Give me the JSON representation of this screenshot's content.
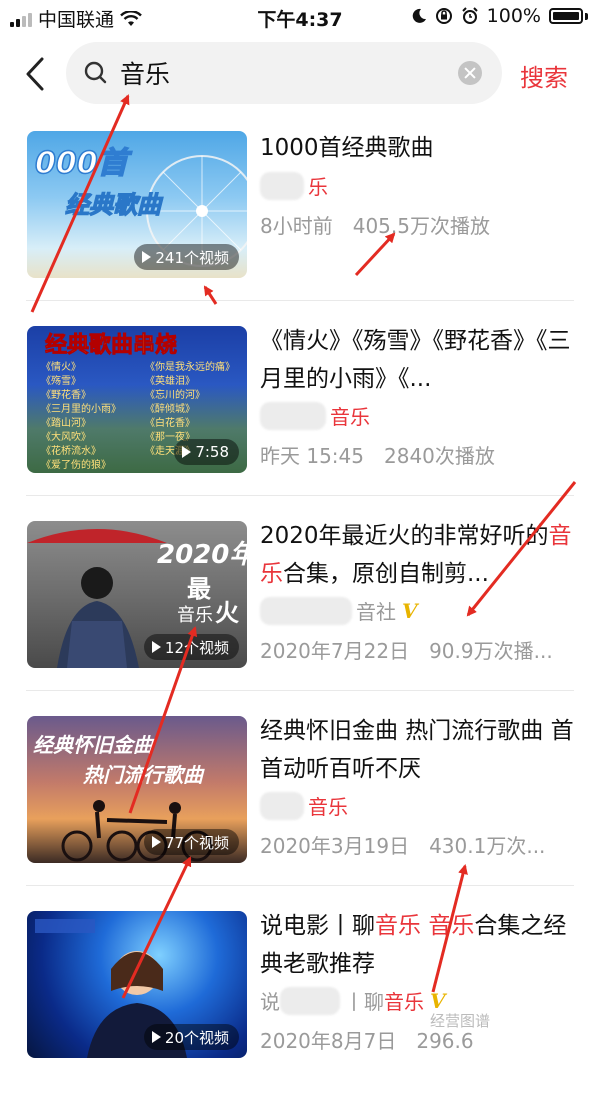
{
  "status": {
    "carrier": "中国联通",
    "time": "下午4:37",
    "battery": "100%"
  },
  "search": {
    "query": "音乐",
    "button": "搜索"
  },
  "results": [
    {
      "title_parts": [
        "1000首经典歌曲"
      ],
      "channel_suffix": "乐",
      "channel_suffix_red": true,
      "vip": false,
      "time": "8小时前",
      "plays": "405.5万次播放",
      "badge": "241个视频"
    },
    {
      "title_parts": [
        "《情火》《殇雪》《野花香》《三月里的小雨》《..."
      ],
      "channel_suffix": "音乐",
      "channel_suffix_red": true,
      "vip": false,
      "time": "昨天 15:45",
      "plays": "2840次播放",
      "badge": "7:58"
    },
    {
      "title_a": "2020年最近火的非常好听的",
      "title_hl": "音乐",
      "title_b": "合集，原创自制剪...",
      "channel_suffix": "音社",
      "channel_suffix_red": false,
      "vip": true,
      "vip_label": "V",
      "time": "2020年7月22日",
      "plays": "90.9万次播...",
      "badge": "12个视频"
    },
    {
      "title_parts": [
        "经典怀旧金曲 热门流行歌曲 首首动听百听不厌"
      ],
      "channel_suffix": "音乐",
      "channel_suffix_red": true,
      "vip": false,
      "time": "2020年3月19日",
      "plays": "430.1万次...",
      "badge": "77个视频"
    },
    {
      "title_a": "说电影丨聊",
      "title_hl": "音乐",
      "title_hl2": "音乐",
      "title_b": "合集之经典老歌推荐",
      "channel_prefix": "说",
      "channel_mid": "丨聊",
      "channel_suffix": "音乐",
      "channel_suffix_red": true,
      "vip": true,
      "vip_label": "V",
      "time": "2020年8月7日",
      "plays": "296.6",
      "badge": "20个视频"
    }
  ],
  "colors": {
    "accent": "#e9353b",
    "annotation_arrow": "#e32b22"
  },
  "watermark": "经营图谱"
}
